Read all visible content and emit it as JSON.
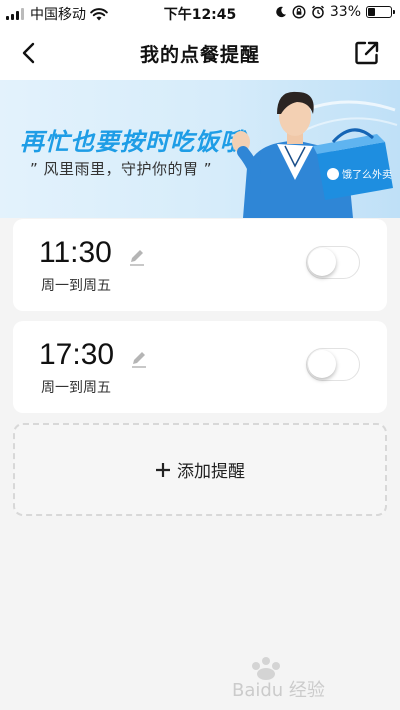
{
  "status_bar": {
    "carrier": "中国移动",
    "time": "下午12:45",
    "battery_percent": "33%",
    "battery_level": 0.33,
    "icons": [
      "signal-icon",
      "wifi-icon",
      "moon-icon",
      "orientation-lock-icon",
      "alarm-icon",
      "battery-icon"
    ]
  },
  "nav": {
    "title": "我的点餐提醒",
    "back_icon": "chevron-left-icon",
    "share_icon": "share-external-icon"
  },
  "banner": {
    "headline": "再忙也要按时吃饭哦",
    "subtitle": "” 风里雨里，守护你的胃 ”",
    "brand_box_text": "饿了么外卖",
    "accent_color": "#1e9de6"
  },
  "reminders": [
    {
      "time": "11:30",
      "days": "周一到周五",
      "enabled": false
    },
    {
      "time": "17:30",
      "days": "周一到周五",
      "enabled": false
    }
  ],
  "add_reminder": {
    "icon": "plus-icon",
    "label": "添加提醒"
  },
  "watermark": {
    "text": "Baidu 经验"
  }
}
